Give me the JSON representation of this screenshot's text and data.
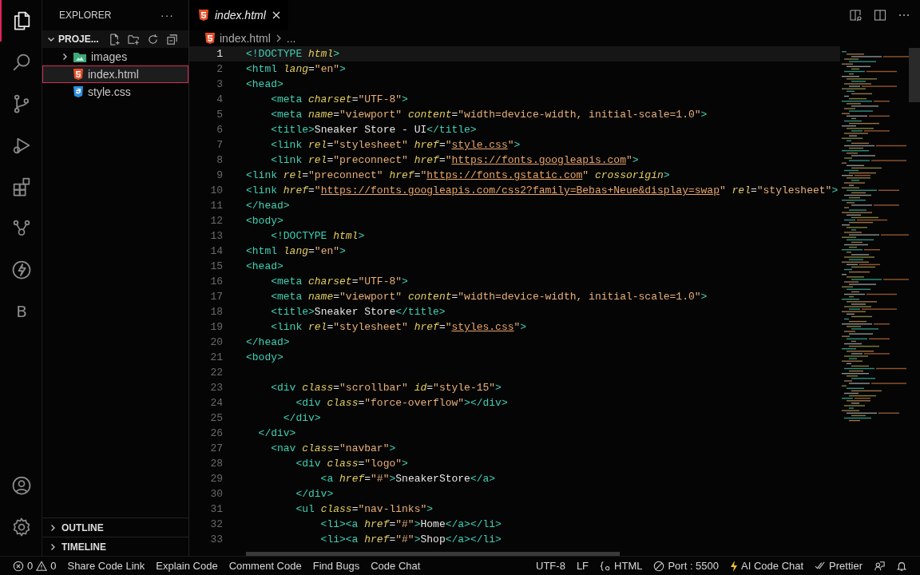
{
  "activity_bar": {
    "items": [
      {
        "kind": "files",
        "selected": true
      },
      {
        "kind": "search",
        "selected": false
      },
      {
        "kind": "source-control",
        "selected": false
      },
      {
        "kind": "run-debug",
        "selected": false
      },
      {
        "kind": "extensions",
        "selected": false
      },
      {
        "kind": "live-share",
        "selected": false
      },
      {
        "kind": "bolt",
        "selected": false
      },
      {
        "kind": "letter",
        "label": "B",
        "selected": false
      }
    ],
    "bottom": [
      {
        "kind": "account"
      },
      {
        "kind": "settings"
      }
    ]
  },
  "sidebar": {
    "title": "EXPLORER",
    "more": "···",
    "project": {
      "label": "PROJE...",
      "expanded": true
    },
    "items": [
      {
        "name": "images",
        "kind": "folder",
        "expanded": false,
        "selected": false
      },
      {
        "name": "index.html",
        "kind": "html",
        "selected": true
      },
      {
        "name": "style.css",
        "kind": "css",
        "selected": false
      }
    ],
    "sections": [
      {
        "label": "OUTLINE",
        "expanded": false
      },
      {
        "label": "TIMELINE",
        "expanded": false
      }
    ]
  },
  "tabs": [
    {
      "label": "index.html",
      "kind": "html",
      "selected": true,
      "preview": true
    }
  ],
  "breadcrumb": [
    "index.html",
    "..."
  ],
  "editor": {
    "lines": [
      {
        "number": "1",
        "current": true,
        "tokens": [
          {
            "kind": "tag",
            "text": "<!DOCTYPE "
          },
          {
            "kind": "attr",
            "text": "html"
          },
          {
            "kind": "tag",
            "text": ">"
          }
        ]
      },
      {
        "number": "2",
        "current": false,
        "tokens": [
          {
            "kind": "tag",
            "text": "<html "
          },
          {
            "kind": "attr",
            "text": "lang"
          },
          {
            "kind": "plain",
            "text": "="
          },
          {
            "kind": "string",
            "text": "\"en\""
          },
          {
            "kind": "tag",
            "text": ">"
          }
        ]
      },
      {
        "number": "3",
        "current": false,
        "tokens": [
          {
            "kind": "tag",
            "text": "<head>"
          }
        ]
      },
      {
        "number": "4",
        "current": false,
        "tokens": [
          {
            "kind": "tag",
            "text": "    <meta "
          },
          {
            "kind": "attr",
            "text": "charset"
          },
          {
            "kind": "plain",
            "text": "="
          },
          {
            "kind": "string",
            "text": "\"UTF-8\""
          },
          {
            "kind": "tag",
            "text": ">"
          }
        ]
      },
      {
        "number": "5",
        "current": false,
        "tokens": [
          {
            "kind": "tag",
            "text": "    <meta "
          },
          {
            "kind": "attr",
            "text": "name"
          },
          {
            "kind": "plain",
            "text": "="
          },
          {
            "kind": "string",
            "text": "\"viewport\" "
          },
          {
            "kind": "attr",
            "text": "content"
          },
          {
            "kind": "plain",
            "text": "="
          },
          {
            "kind": "string",
            "text": "\"width=device-width, initial-scale=1.0\""
          },
          {
            "kind": "tag",
            "text": ">"
          }
        ]
      },
      {
        "number": "6",
        "current": false,
        "tokens": [
          {
            "kind": "tag",
            "text": "    <title>"
          },
          {
            "kind": "plain",
            "text": "Sneaker Store - UI"
          },
          {
            "kind": "tag",
            "text": "</title>"
          }
        ]
      },
      {
        "number": "7",
        "current": false,
        "tokens": [
          {
            "kind": "tag",
            "text": "    <link "
          },
          {
            "kind": "attr",
            "text": "rel"
          },
          {
            "kind": "plain",
            "text": "="
          },
          {
            "kind": "string",
            "text": "\"stylesheet\" "
          },
          {
            "kind": "attr",
            "text": "href"
          },
          {
            "kind": "plain",
            "text": "="
          },
          {
            "kind": "string",
            "text": "\""
          },
          {
            "kind": "url",
            "text": "style.css"
          },
          {
            "kind": "string",
            "text": "\""
          },
          {
            "kind": "tag",
            "text": ">"
          }
        ]
      },
      {
        "number": "8",
        "current": false,
        "tokens": [
          {
            "kind": "tag",
            "text": "    <link "
          },
          {
            "kind": "attr",
            "text": "rel"
          },
          {
            "kind": "plain",
            "text": "="
          },
          {
            "kind": "string",
            "text": "\"preconnect\" "
          },
          {
            "kind": "attr",
            "text": "href"
          },
          {
            "kind": "plain",
            "text": "="
          },
          {
            "kind": "string",
            "text": "\""
          },
          {
            "kind": "url",
            "text": "https://fonts.googleapis.com"
          },
          {
            "kind": "string",
            "text": "\""
          },
          {
            "kind": "tag",
            "text": ">"
          }
        ]
      },
      {
        "number": "9",
        "current": false,
        "tokens": [
          {
            "kind": "tag",
            "text": "<link "
          },
          {
            "kind": "attr",
            "text": "rel"
          },
          {
            "kind": "plain",
            "text": "="
          },
          {
            "kind": "string",
            "text": "\"preconnect\" "
          },
          {
            "kind": "attr",
            "text": "href"
          },
          {
            "kind": "plain",
            "text": "="
          },
          {
            "kind": "string",
            "text": "\""
          },
          {
            "kind": "url",
            "text": "https://fonts.gstatic.com"
          },
          {
            "kind": "string",
            "text": "\" "
          },
          {
            "kind": "attr",
            "text": "crossorigin"
          },
          {
            "kind": "tag",
            "text": ">"
          }
        ]
      },
      {
        "number": "10",
        "current": false,
        "tokens": [
          {
            "kind": "tag",
            "text": "<link "
          },
          {
            "kind": "attr",
            "text": "href"
          },
          {
            "kind": "plain",
            "text": "="
          },
          {
            "kind": "string",
            "text": "\""
          },
          {
            "kind": "url",
            "text": "https://fonts.googleapis.com/css2?family=Bebas+Neue&display=swap"
          },
          {
            "kind": "string",
            "text": "\" "
          },
          {
            "kind": "attr",
            "text": "rel"
          },
          {
            "kind": "plain",
            "text": "="
          },
          {
            "kind": "string",
            "text": "\"stylesheet\""
          },
          {
            "kind": "tag",
            "text": ">"
          }
        ]
      },
      {
        "number": "11",
        "current": false,
        "tokens": [
          {
            "kind": "tag",
            "text": "</head>"
          }
        ]
      },
      {
        "number": "12",
        "current": false,
        "tokens": [
          {
            "kind": "tag",
            "text": "<body>"
          }
        ]
      },
      {
        "number": "13",
        "current": false,
        "tokens": [
          {
            "kind": "tag",
            "text": "    <!DOCTYPE "
          },
          {
            "kind": "attr",
            "text": "html"
          },
          {
            "kind": "tag",
            "text": ">"
          }
        ]
      },
      {
        "number": "14",
        "current": false,
        "tokens": [
          {
            "kind": "tag",
            "text": "<html "
          },
          {
            "kind": "attr",
            "text": "lang"
          },
          {
            "kind": "plain",
            "text": "="
          },
          {
            "kind": "string",
            "text": "\"en\""
          },
          {
            "kind": "tag",
            "text": ">"
          }
        ]
      },
      {
        "number": "15",
        "current": false,
        "tokens": [
          {
            "kind": "tag",
            "text": "<head>"
          }
        ]
      },
      {
        "number": "16",
        "current": false,
        "tokens": [
          {
            "kind": "tag",
            "text": "    <meta "
          },
          {
            "kind": "attr",
            "text": "charset"
          },
          {
            "kind": "plain",
            "text": "="
          },
          {
            "kind": "string",
            "text": "\"UTF-8\""
          },
          {
            "kind": "tag",
            "text": ">"
          }
        ]
      },
      {
        "number": "17",
        "current": false,
        "tokens": [
          {
            "kind": "tag",
            "text": "    <meta "
          },
          {
            "kind": "attr",
            "text": "name"
          },
          {
            "kind": "plain",
            "text": "="
          },
          {
            "kind": "string",
            "text": "\"viewport\" "
          },
          {
            "kind": "attr",
            "text": "content"
          },
          {
            "kind": "plain",
            "text": "="
          },
          {
            "kind": "string",
            "text": "\"width=device-width, initial-scale=1.0\""
          },
          {
            "kind": "tag",
            "text": ">"
          }
        ]
      },
      {
        "number": "18",
        "current": false,
        "tokens": [
          {
            "kind": "tag",
            "text": "    <title>"
          },
          {
            "kind": "plain",
            "text": "Sneaker Store"
          },
          {
            "kind": "tag",
            "text": "</title>"
          }
        ]
      },
      {
        "number": "19",
        "current": false,
        "tokens": [
          {
            "kind": "tag",
            "text": "    <link "
          },
          {
            "kind": "attr",
            "text": "rel"
          },
          {
            "kind": "plain",
            "text": "="
          },
          {
            "kind": "string",
            "text": "\"stylesheet\" "
          },
          {
            "kind": "attr",
            "text": "href"
          },
          {
            "kind": "plain",
            "text": "="
          },
          {
            "kind": "string",
            "text": "\""
          },
          {
            "kind": "url",
            "text": "styles.css"
          },
          {
            "kind": "string",
            "text": "\""
          },
          {
            "kind": "tag",
            "text": ">"
          }
        ]
      },
      {
        "number": "20",
        "current": false,
        "tokens": [
          {
            "kind": "tag",
            "text": "</head>"
          }
        ]
      },
      {
        "number": "21",
        "current": false,
        "tokens": [
          {
            "kind": "tag",
            "text": "<body>"
          }
        ]
      },
      {
        "number": "22",
        "current": false
      },
      {
        "number": "23",
        "current": false,
        "tokens": [
          {
            "kind": "tag",
            "text": "    <div "
          },
          {
            "kind": "attr",
            "text": "class"
          },
          {
            "kind": "plain",
            "text": "="
          },
          {
            "kind": "string",
            "text": "\"scrollbar\" "
          },
          {
            "kind": "attr",
            "text": "id"
          },
          {
            "kind": "plain",
            "text": "="
          },
          {
            "kind": "string",
            "text": "\"style-15\""
          },
          {
            "kind": "tag",
            "text": ">"
          }
        ]
      },
      {
        "number": "24",
        "current": false,
        "tokens": [
          {
            "kind": "tag",
            "text": "        <div "
          },
          {
            "kind": "attr",
            "text": "class"
          },
          {
            "kind": "plain",
            "text": "="
          },
          {
            "kind": "string",
            "text": "\"force-overflow\""
          },
          {
            "kind": "tag",
            "text": "></div>"
          }
        ]
      },
      {
        "number": "25",
        "current": false,
        "tokens": [
          {
            "kind": "tag",
            "text": "      </div>"
          }
        ]
      },
      {
        "number": "26",
        "current": false,
        "tokens": [
          {
            "kind": "tag",
            "text": "  </div>"
          }
        ]
      },
      {
        "number": "27",
        "current": false,
        "tokens": [
          {
            "kind": "tag",
            "text": "    <nav "
          },
          {
            "kind": "attr",
            "text": "class"
          },
          {
            "kind": "plain",
            "text": "="
          },
          {
            "kind": "string",
            "text": "\"navbar\""
          },
          {
            "kind": "tag",
            "text": ">"
          }
        ]
      },
      {
        "number": "28",
        "current": false,
        "tokens": [
          {
            "kind": "tag",
            "text": "        <div "
          },
          {
            "kind": "attr",
            "text": "class"
          },
          {
            "kind": "plain",
            "text": "="
          },
          {
            "kind": "string",
            "text": "\"logo\""
          },
          {
            "kind": "tag",
            "text": ">"
          }
        ]
      },
      {
        "number": "29",
        "current": false,
        "tokens": [
          {
            "kind": "tag",
            "text": "            <a "
          },
          {
            "kind": "attr",
            "text": "href"
          },
          {
            "kind": "plain",
            "text": "="
          },
          {
            "kind": "string",
            "text": "\"#\""
          },
          {
            "kind": "tag",
            "text": ">"
          },
          {
            "kind": "plain",
            "text": "SneakerStore"
          },
          {
            "kind": "tag",
            "text": "</a>"
          }
        ]
      },
      {
        "number": "30",
        "current": false,
        "tokens": [
          {
            "kind": "tag",
            "text": "        </div>"
          }
        ]
      },
      {
        "number": "31",
        "current": false,
        "tokens": [
          {
            "kind": "tag",
            "text": "        <ul "
          },
          {
            "kind": "attr",
            "text": "class"
          },
          {
            "kind": "plain",
            "text": "="
          },
          {
            "kind": "string",
            "text": "\"nav-links\""
          },
          {
            "kind": "tag",
            "text": ">"
          }
        ]
      },
      {
        "number": "32",
        "current": false,
        "tokens": [
          {
            "kind": "tag",
            "text": "            <li><a "
          },
          {
            "kind": "attr",
            "text": "href"
          },
          {
            "kind": "plain",
            "text": "="
          },
          {
            "kind": "string",
            "text": "\"#\""
          },
          {
            "kind": "tag",
            "text": ">"
          },
          {
            "kind": "plain",
            "text": "Home"
          },
          {
            "kind": "tag",
            "text": "</a></li>"
          }
        ]
      },
      {
        "number": "33",
        "current": false,
        "tokens": [
          {
            "kind": "tag",
            "text": "            <li><a "
          },
          {
            "kind": "attr",
            "text": "href"
          },
          {
            "kind": "plain",
            "text": "="
          },
          {
            "kind": "string",
            "text": "\"#\""
          },
          {
            "kind": "tag",
            "text": ">"
          },
          {
            "kind": "plain",
            "text": "Shop"
          },
          {
            "kind": "tag",
            "text": "</a></li>"
          }
        ]
      }
    ]
  },
  "status_bar": {
    "left": [
      {
        "kind": "problems",
        "errors": "0",
        "warnings": "0"
      },
      {
        "kind": "text",
        "label": "Share Code Link"
      },
      {
        "kind": "text",
        "label": "Explain Code"
      },
      {
        "kind": "text",
        "label": "Comment Code"
      },
      {
        "kind": "text",
        "label": "Find Bugs"
      },
      {
        "kind": "text",
        "label": "Code Chat"
      }
    ],
    "right": [
      {
        "kind": "text",
        "label": "UTF-8"
      },
      {
        "kind": "text",
        "label": "LF"
      },
      {
        "kind": "language",
        "label": "HTML"
      },
      {
        "kind": "port",
        "label": "Port : 5500"
      },
      {
        "kind": "bolt",
        "label": "AI Code Chat"
      },
      {
        "kind": "check",
        "label": "Prettier"
      },
      {
        "kind": "feedback"
      },
      {
        "kind": "bell"
      }
    ]
  }
}
